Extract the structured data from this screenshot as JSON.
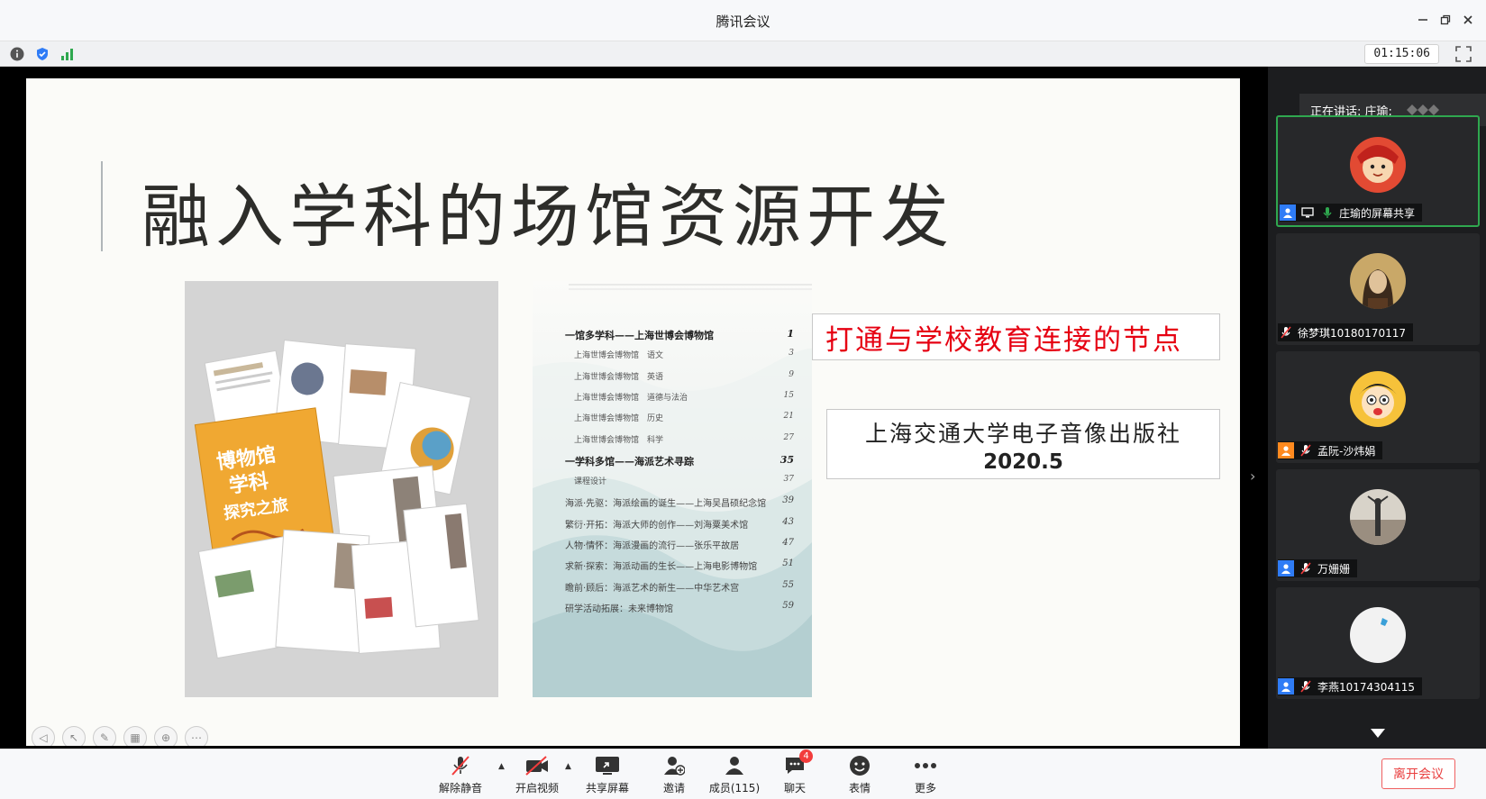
{
  "window": {
    "title": "腾讯会议"
  },
  "status": {
    "timer": "01:15:06"
  },
  "slide": {
    "heading": "融入学科的场馆资源开发",
    "callout": "打通与学校教育连接的节点",
    "publisher": "上海交通大学电子音像出版社",
    "year": "2020.5",
    "book_cover_text": "博物馆学科探究之旅",
    "toc": [
      {
        "text": "一馆多学科——上海世博会博物馆",
        "page": "1",
        "kind": "bold"
      },
      {
        "text": "上海世博会博物馆　语文",
        "page": "3",
        "kind": "sub"
      },
      {
        "text": "上海世博会博物馆　英语",
        "page": "9",
        "kind": "sub"
      },
      {
        "text": "上海世博会博物馆　道德与法治",
        "page": "15",
        "kind": "sub"
      },
      {
        "text": "上海世博会博物馆　历史",
        "page": "21",
        "kind": "sub"
      },
      {
        "text": "上海世博会博物馆　科学",
        "page": "27",
        "kind": "sub"
      },
      {
        "text": "一学科多馆——海派艺术寻踪",
        "page": "35",
        "kind": "bold"
      },
      {
        "text": "课程设计",
        "page": "37",
        "kind": "sub"
      },
      {
        "text": "海派·先驱：海派绘画的诞生——上海吴昌硕纪念馆",
        "page": "39",
        "kind": "normal"
      },
      {
        "text": "繁衍·开拓：海派大师的创作——刘海粟美术馆",
        "page": "43",
        "kind": "normal"
      },
      {
        "text": "人物·情怀：海派漫画的流行——张乐平故居",
        "page": "47",
        "kind": "normal"
      },
      {
        "text": "求新·探索：海派动画的生长——上海电影博物馆",
        "page": "51",
        "kind": "normal"
      },
      {
        "text": "瞻前·顾后：海派艺术的新生——中华艺术宫",
        "page": "55",
        "kind": "normal"
      },
      {
        "text": "研学活动拓展：未来博物馆",
        "page": "59",
        "kind": "normal"
      }
    ]
  },
  "panel": {
    "speaking": "正在讲话: 庄瑜;",
    "participants": [
      {
        "name": "庄瑜的屏幕共享"
      },
      {
        "name": "徐梦琪10180170117"
      },
      {
        "name": "孟阮-沙炜娟"
      },
      {
        "name": "万姗姗"
      },
      {
        "name": "李燕10174304115"
      }
    ]
  },
  "toolbar": {
    "mic": "解除静音",
    "video": "开启视频",
    "share": "共享屏幕",
    "invite": "邀请",
    "members": "成员(115)",
    "chat": "聊天",
    "chat_badge": "4",
    "emoji": "表情",
    "more": "更多",
    "leave": "离开会议"
  },
  "colors": {
    "accent_green": "#2fa84f",
    "leave_red": "#e94040",
    "callout_red": "#e60012",
    "user_blue": "#2f7cf6"
  }
}
